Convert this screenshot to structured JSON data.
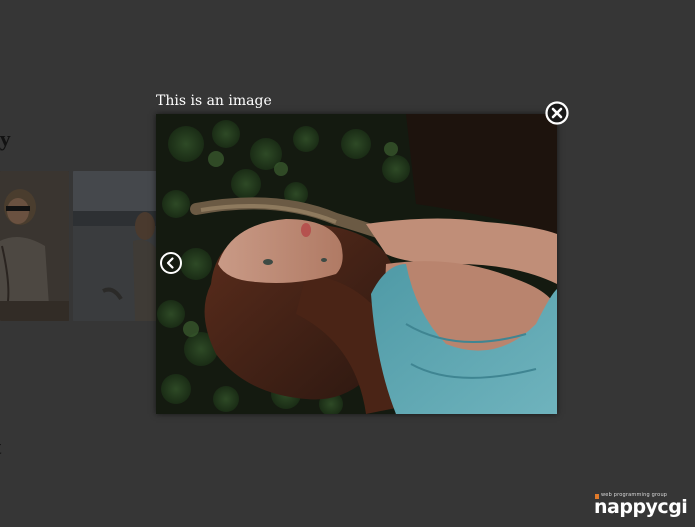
{
  "background": {
    "heading_1": "ry",
    "heading_2": "ent"
  },
  "lightbox": {
    "caption": "This is an image",
    "image_description_icon": "photo-image"
  },
  "controls": {
    "close_icon": "close-icon",
    "prev_icon": "chevron-left-icon"
  },
  "logo": {
    "tagline": "web programming group",
    "name": "nappycgi"
  },
  "colors": {
    "page_background": "#363636",
    "accent": "#e07a2a"
  }
}
